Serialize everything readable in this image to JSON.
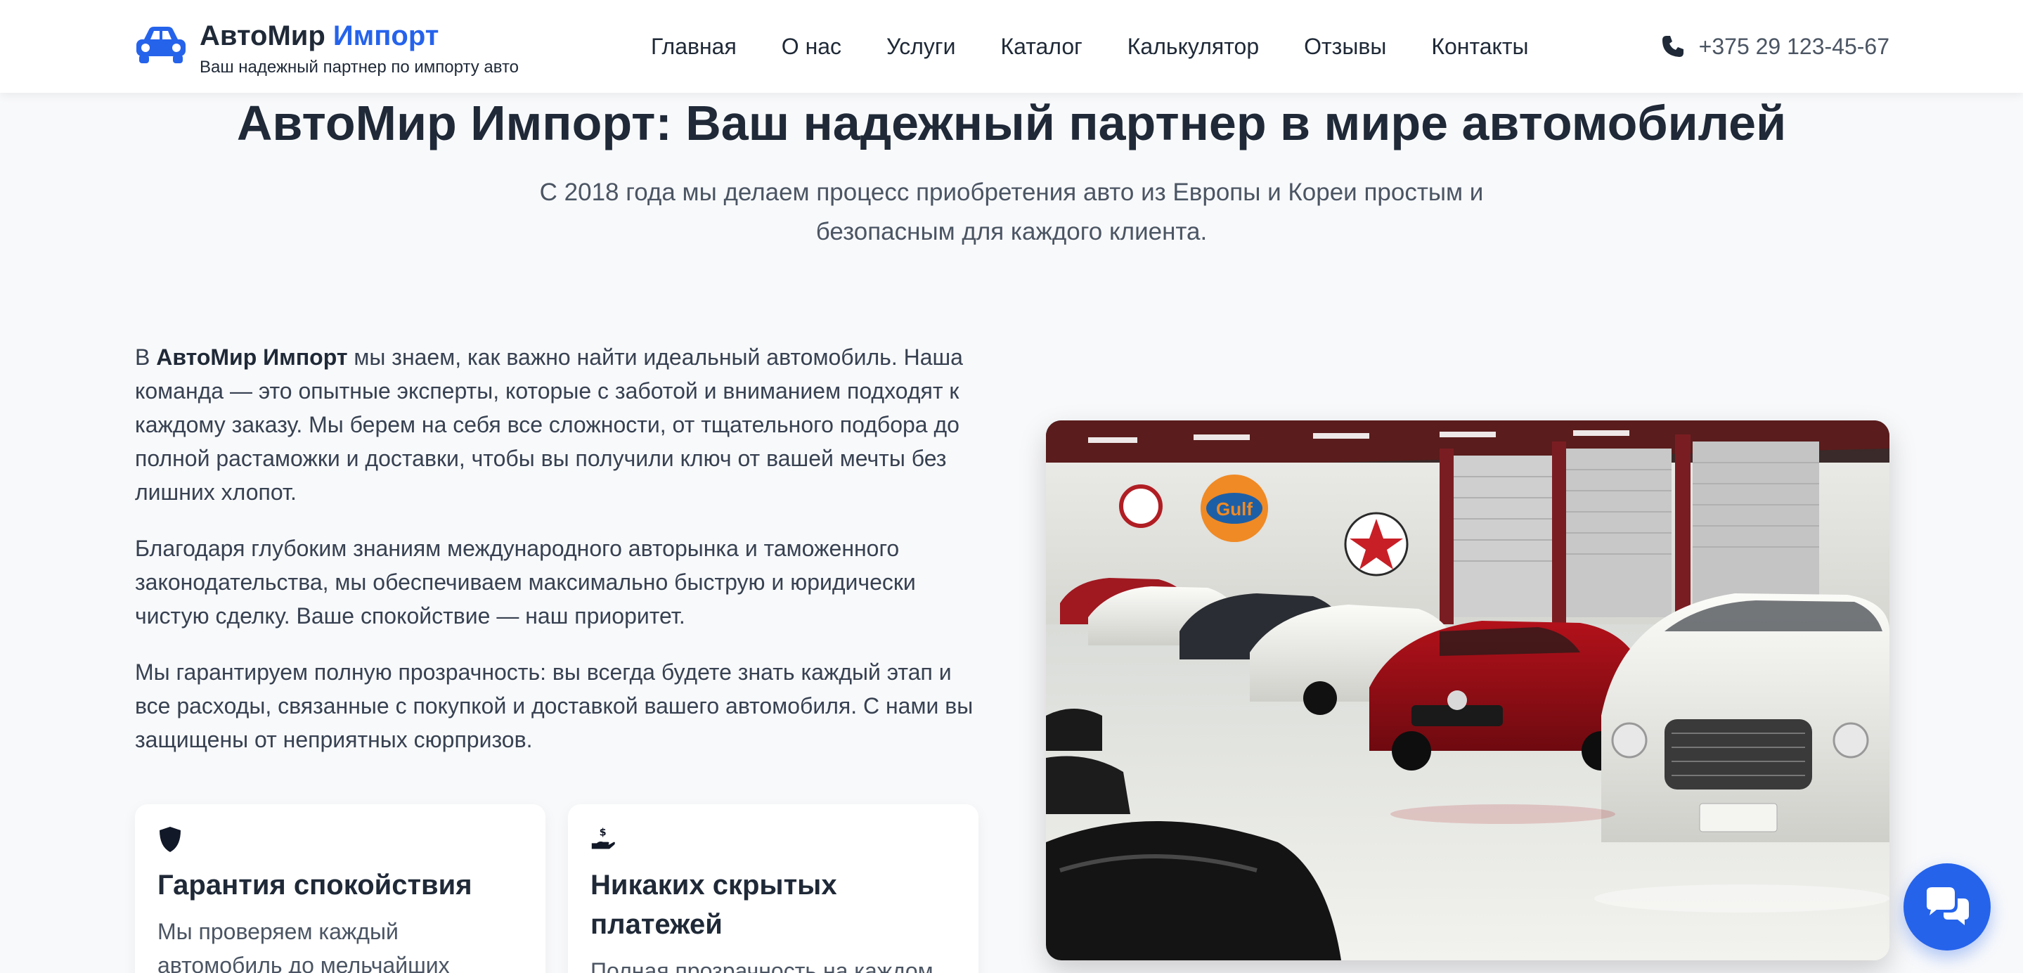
{
  "header": {
    "brand_main": "АвтоМир",
    "brand_accent": "Импорт",
    "tagline": "Ваш надежный партнер по импорту авто",
    "logo_icon": "car-icon",
    "nav": [
      {
        "label": "Главная"
      },
      {
        "label": "О нас"
      },
      {
        "label": "Услуги"
      },
      {
        "label": "Каталог"
      },
      {
        "label": "Калькулятор"
      },
      {
        "label": "Отзывы"
      },
      {
        "label": "Контакты"
      }
    ],
    "phone_icon": "phone-icon",
    "phone": "+375 29 123-45-67"
  },
  "hero": {
    "title": "АвтоМир Импорт: Ваш надежный партнер в мире автомобилей",
    "subtitle": "С 2018 года мы делаем процесс приобретения авто из Европы и Кореи простым и безопасным для каждого клиента."
  },
  "about": {
    "p1_prefix": "В ",
    "p1_bold": "АвтоМир Импорт",
    "p1_rest": " мы знаем, как важно найти идеальный автомобиль. Наша команда — это опытные эксперты, которые с заботой и вниманием подходят к каждому заказу. Мы берем на себя все сложности, от тщательного подбора до полной растаможки и доставки, чтобы вы получили ключ от вашей мечты без лишних хлопот.",
    "p2": "Благодаря глубоким знаниям международного авторынка и таможенного законодательства, мы обеспечиваем максимально быструю и юридически чистую сделку. Ваше спокойствие — наш приоритет.",
    "p3": "Мы гарантируем полную прозрачность: вы всегда будете знать каждый этап и все расходы, связанные с покупкой и доставкой вашего автомобиля. С нами вы защищены от неприятных сюрпризов."
  },
  "features": [
    {
      "icon": "shield-icon",
      "title": "Гарантия спокойствия",
      "text": "Мы проверяем каждый автомобиль до мельчайших"
    },
    {
      "icon": "hand-dollar-icon",
      "title": "Никаких скрытых платежей",
      "text": "Полная прозрачность на каждом"
    }
  ],
  "media": {
    "image": "car-showroom-photo"
  },
  "chat": {
    "icon": "chat-bubbles-icon"
  },
  "colors": {
    "accent": "#2563eb",
    "text": "#1f2937",
    "muted": "#4b5563",
    "background": "#f8f9fb"
  }
}
